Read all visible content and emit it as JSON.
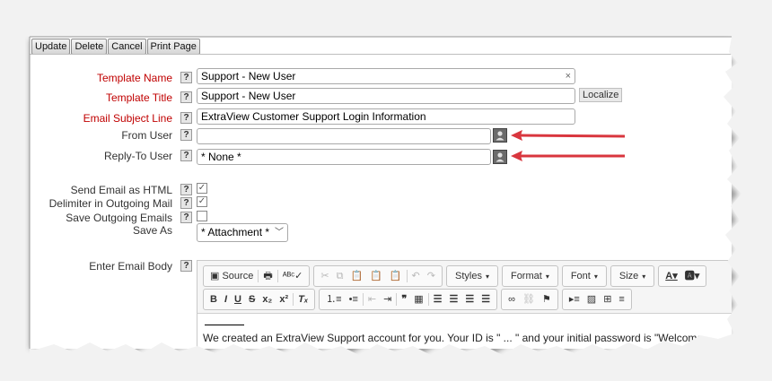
{
  "toolbar": {
    "update": "Update",
    "delete": "Delete",
    "cancel": "Cancel",
    "print_page": "Print Page"
  },
  "form": {
    "template_name": {
      "label": "Template Name",
      "value": "Support - New User",
      "clear_glyph": "×"
    },
    "template_title": {
      "label": "Template Title",
      "value": "Support - New User",
      "localize": "Localize"
    },
    "email_subject": {
      "label": "Email Subject Line",
      "value": "ExtraView Customer Support Login Information"
    },
    "from_user": {
      "label": "From User",
      "value": ""
    },
    "reply_to": {
      "label": "Reply-To User",
      "value": "* None *"
    },
    "send_html": {
      "label": "Send Email as HTML",
      "checked": true
    },
    "delimiter": {
      "label": "Delimiter in Outgoing Mail",
      "checked": true
    },
    "save_outgoing": {
      "label": "Save Outgoing Emails",
      "checked": false
    },
    "save_as": {
      "label": "Save As",
      "value": "* Attachment *"
    },
    "email_body": {
      "label": "Enter Email Body"
    },
    "help_glyph": "?"
  },
  "editor": {
    "source": "Source",
    "styles": "Styles",
    "format": "Format",
    "font": "Font",
    "size": "Size",
    "body_text": "We created an ExtraView Support account for you. Your ID is \" ... \" and your initial password is \"Welcome"
  },
  "colors": {
    "required_label": "#c00000",
    "arrow": "#d9363e",
    "picker_bg": "#6b6b6b"
  }
}
